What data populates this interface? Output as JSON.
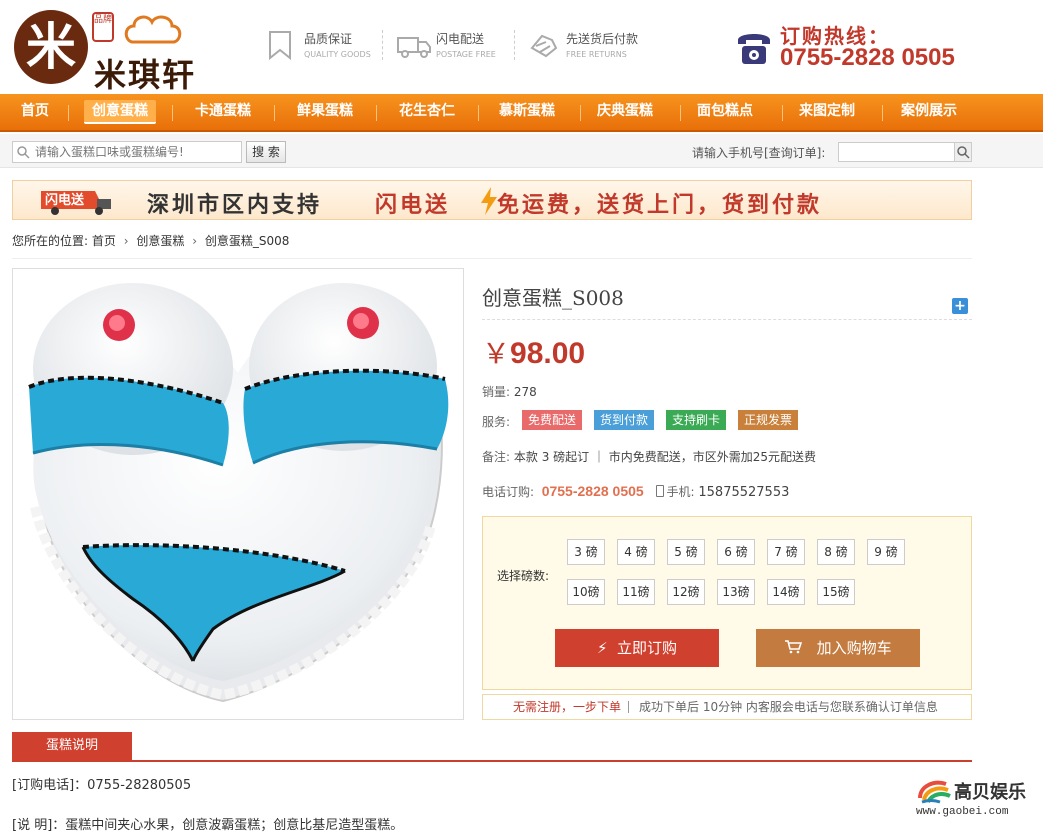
{
  "brand": {
    "logo_char": "米",
    "seal_text": "品牌",
    "name": "米琪轩"
  },
  "features": [
    {
      "title": "品质保证",
      "subtitle": "QUALITY GOODS",
      "icon": "bookmark-icon"
    },
    {
      "title": "闪电配送",
      "subtitle": "POSTAGE FREE",
      "icon": "truck-icon"
    },
    {
      "title": "先送货后付款",
      "subtitle": "FREE RETURNS",
      "icon": "return-icon"
    }
  ],
  "hotline": {
    "label": "订购热线：",
    "number": "0755-2828 0505"
  },
  "nav": {
    "items": [
      "首页",
      "创意蛋糕",
      "卡通蛋糕",
      "鲜果蛋糕",
      "花生杏仁",
      "慕斯蛋糕",
      "庆典蛋糕",
      "面包糕点",
      "来图定制",
      "案例展示"
    ],
    "active_index": 1
  },
  "search": {
    "placeholder": "请输入蛋糕口味或蛋糕编号!",
    "button": "搜 索",
    "order_label": "请输入手机号[查询订单]:"
  },
  "banner": {
    "badge": "闪电送",
    "text1": "深圳市区内支持",
    "text2": "闪电送",
    "text3": "免运费，送货上门，货到付款"
  },
  "breadcrumb": {
    "prefix": "您所在的位置:",
    "items": [
      "首页",
      "创意蛋糕",
      "创意蛋糕_S008"
    ]
  },
  "product": {
    "title": "创意蛋糕_S008",
    "currency": "￥",
    "price": "98.00",
    "sales_label": "销量:",
    "sales": "278",
    "service_label": "服务:",
    "services": [
      {
        "label": "免费配送",
        "color": "#e86a6a"
      },
      {
        "label": "货到付款",
        "color": "#4a9fd8"
      },
      {
        "label": "支持刷卡",
        "color": "#3aaa55"
      },
      {
        "label": "正规发票",
        "color": "#c8803a"
      }
    ],
    "remark_label": "备注:",
    "remark": "本款 3 磅起订 ｜ 市内免费配送，市区外需加25元配送费",
    "phone_label": "电话订购:",
    "phone": "0755-2828 0505",
    "mobile_label": "手机:",
    "mobile": "15875527553"
  },
  "weights": {
    "label": "选择磅数:",
    "options": [
      "3 磅",
      "4 磅",
      "5 磅",
      "6 磅",
      "7 磅",
      "8 磅",
      "9 磅",
      "10磅",
      "11磅",
      "12磅",
      "13磅",
      "14磅",
      "15磅"
    ]
  },
  "actions": {
    "buy": "立即订购",
    "cart": "加入购物车"
  },
  "notice": {
    "highlight": "无需注册，一步下单",
    "text": "成功下单后 10分钟 内客服会电话与您联系确认订单信息"
  },
  "description": {
    "tab": "蛋糕说明",
    "line1": "[订购电话]：0755-28280505",
    "line2": "[说 明]：蛋糕中间夹心水果，创意波霸蛋糕；创意比基尼造型蛋糕。"
  },
  "watermark": {
    "name": "高贝娱乐",
    "url": "www.gaobei.com"
  },
  "colors": {
    "accent": "#f7931e",
    "price": "#c0392b",
    "buy": "#d0402e",
    "cart": "#c47b3f"
  }
}
